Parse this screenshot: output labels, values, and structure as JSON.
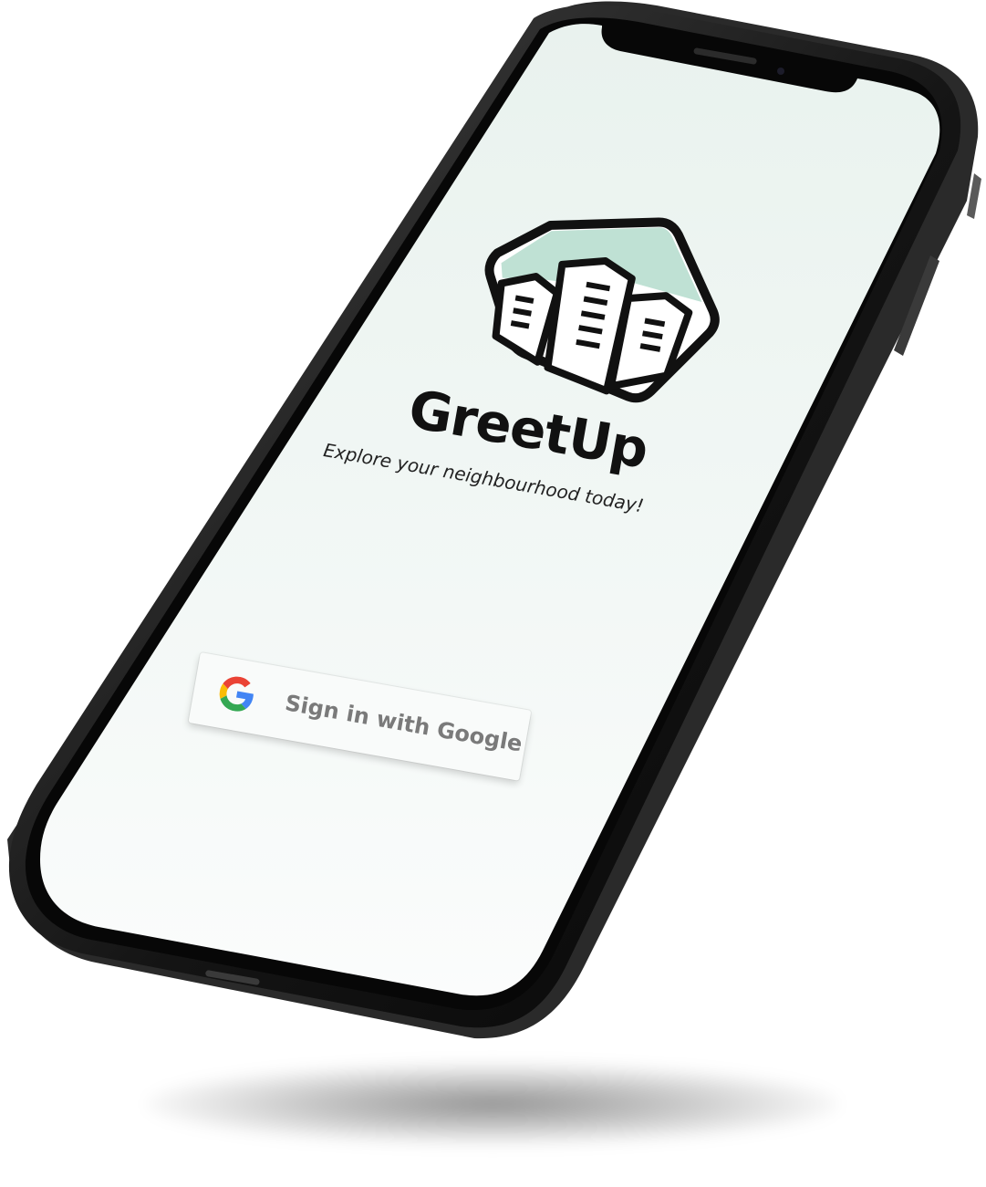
{
  "app": {
    "title": "GreetUp",
    "subtitle": "Explore your neighbourhood today!"
  },
  "signin": {
    "label": "Sign in with Google",
    "icon": "google-g-icon"
  },
  "logo": {
    "icon": "city-buildings-hex-logo",
    "accent_color": "#bfe1d4"
  },
  "colors": {
    "screen_bg": "#f4f8f6",
    "phone_body": "#111111",
    "text_primary": "#111111",
    "button_text": "#7a7a7a"
  }
}
